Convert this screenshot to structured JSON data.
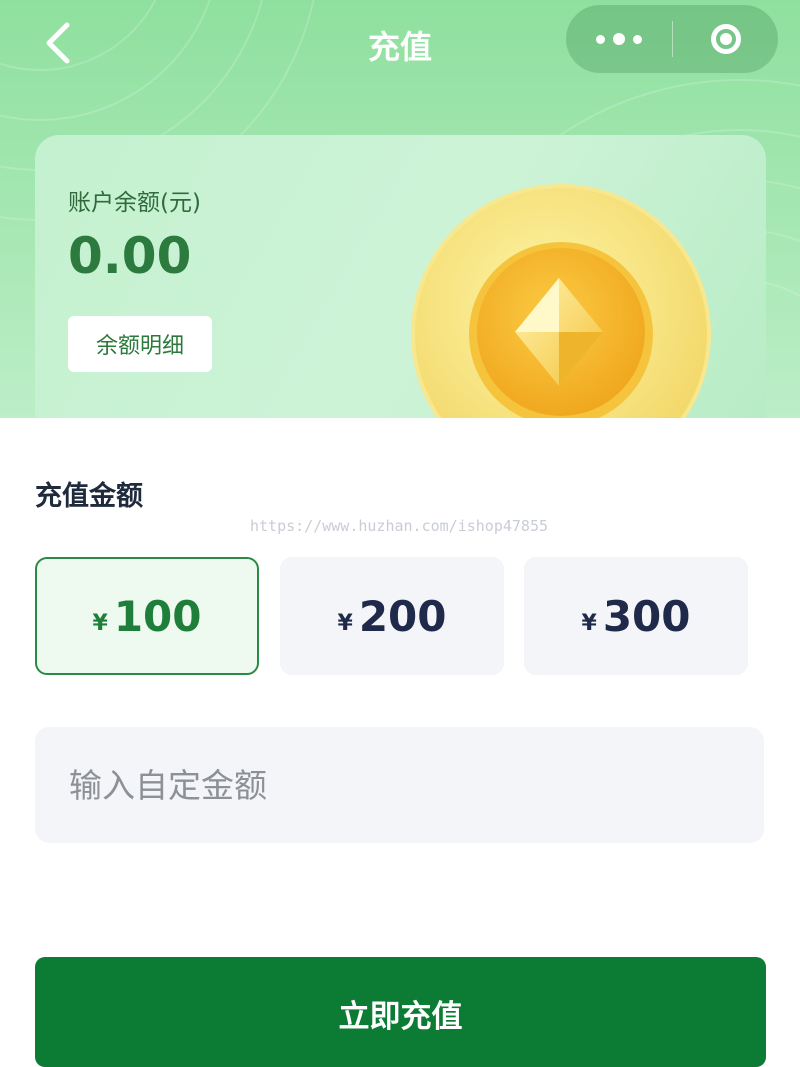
{
  "nav": {
    "title": "充值",
    "back_icon": "chevron-left-icon",
    "more_icon": "more-dots-icon",
    "close_icon": "target-close-icon"
  },
  "balance": {
    "label": "账户余额(元)",
    "value": "0.00",
    "detail_button": "余额明细",
    "coin_icon": "gold-coin-icon"
  },
  "recharge": {
    "section_title": "充值金额",
    "watermark": "https://www.huzhan.com/ishop47855",
    "currency_symbol": "¥",
    "options": [
      {
        "amount": "100",
        "selected": true
      },
      {
        "amount": "200",
        "selected": false
      },
      {
        "amount": "300",
        "selected": false
      }
    ],
    "custom_placeholder": "输入自定金额",
    "submit_label": "立即充值"
  },
  "colors": {
    "brand_green": "#0c7c34",
    "selected_border": "#2b8a45",
    "header_green": "#8fe09e"
  }
}
